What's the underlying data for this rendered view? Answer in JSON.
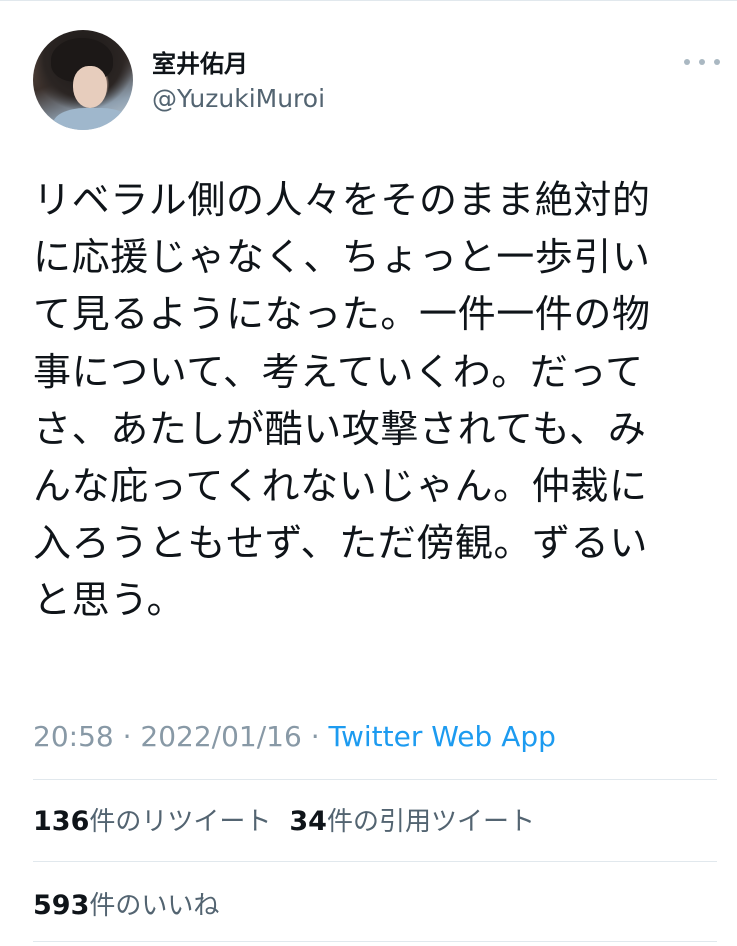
{
  "author": {
    "display_name": "室井佑月",
    "handle": "@YuzukiMuroi"
  },
  "tweet": {
    "lines": [
      "リベラル側の人々をそのまま絶対的",
      "に応援じゃなく、ちょっと一歩引い",
      "て見るようになった。一件一件の物",
      "事について、考えていくわ。だって",
      "さ、あたしが酷い攻撃されても、み",
      "んな庇ってくれないじゃん。仲裁に",
      "入ろうともせず、ただ傍観。ずるい",
      "と思う。"
    ],
    "time": "20:58",
    "separator1": " · ",
    "date": "2022/01/16",
    "separator2": " · ",
    "source": "Twitter Web App"
  },
  "stats": {
    "retweets": {
      "count": "136",
      "label": "件のリツイート"
    },
    "quotes": {
      "count": "34",
      "label": "件の引用ツイート"
    },
    "likes": {
      "count": "593",
      "label": "件のいいね"
    }
  },
  "icons": {
    "more": "more-horizontal-icon"
  },
  "colors": {
    "text": "#0f1419",
    "secondary": "#536471",
    "meta": "#8899a6",
    "link": "#1d9bf0",
    "divider": "#e1e8ed"
  }
}
